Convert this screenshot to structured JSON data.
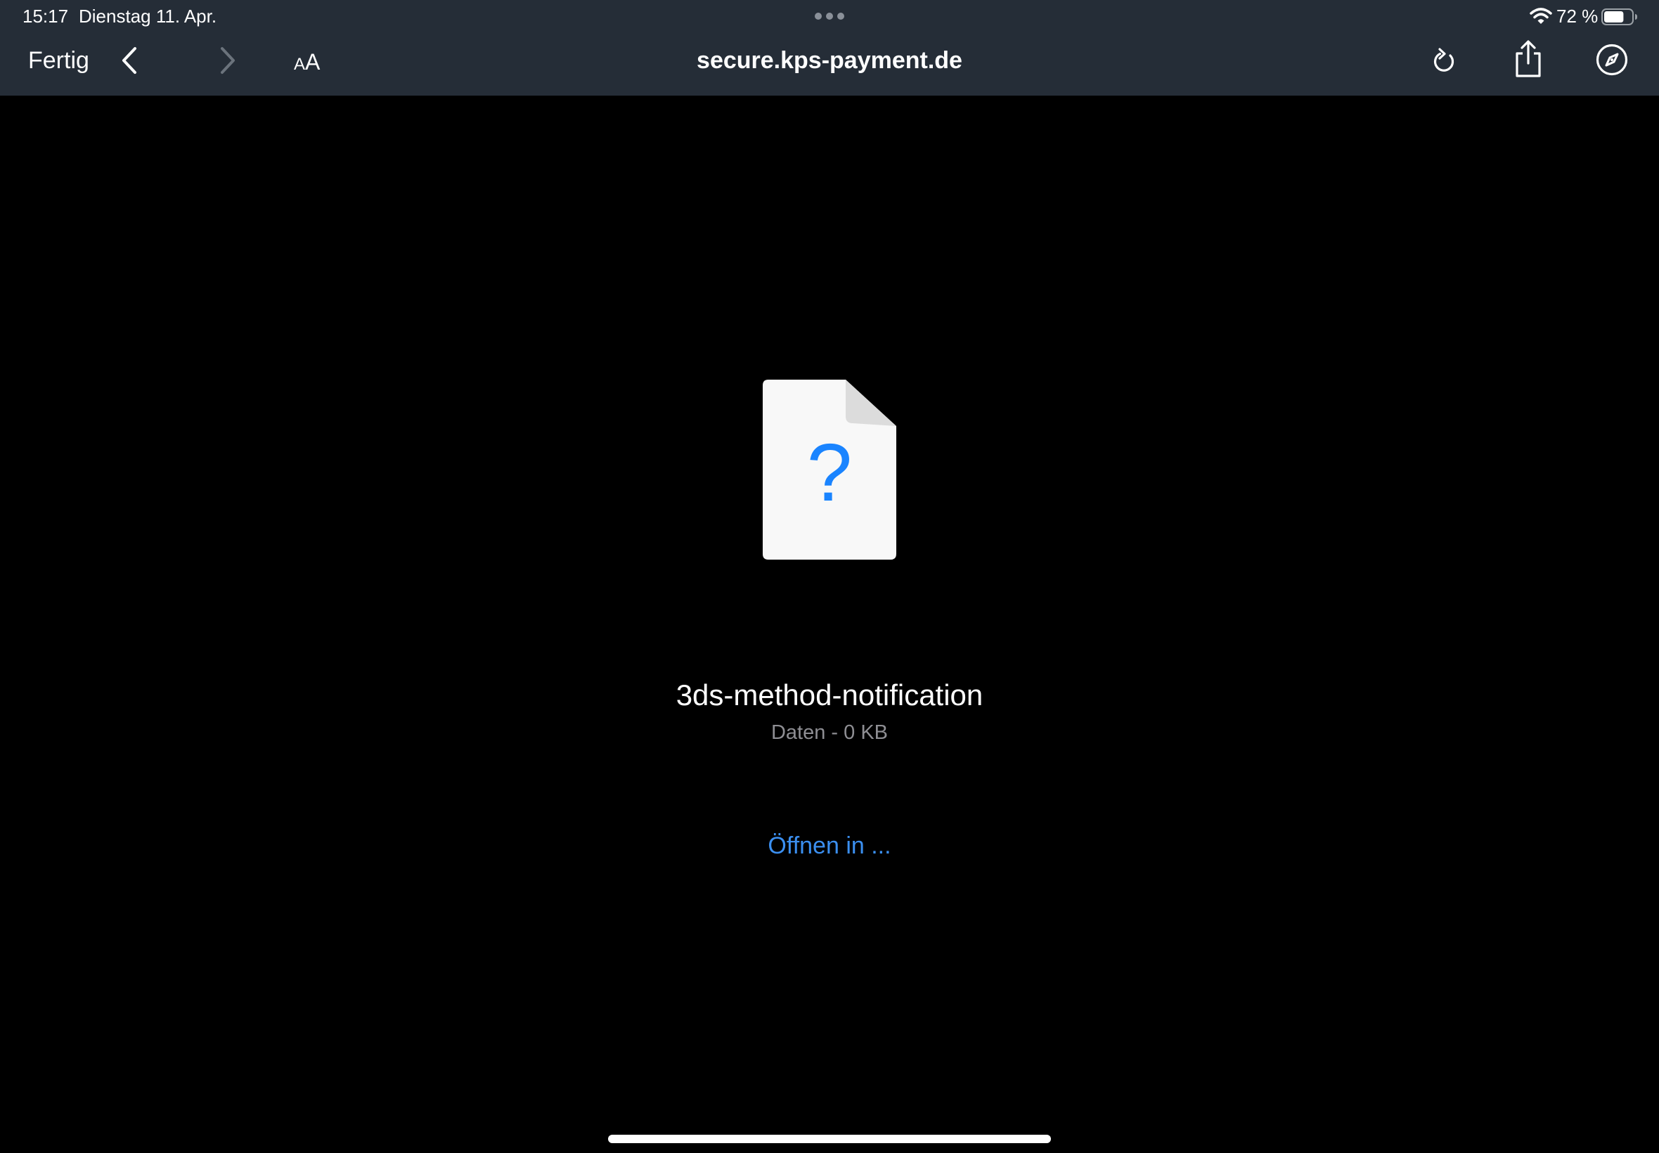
{
  "status_bar": {
    "time": "15:17",
    "date": "Dienstag 11. Apr.",
    "battery_percent": "72 %",
    "battery_level": 0.72
  },
  "toolbar": {
    "done_label": "Fertig",
    "text_size_small": "A",
    "text_size_large": "A",
    "url": "secure.kps-payment.de"
  },
  "icons": {
    "back": "chevron-left-icon",
    "forward": "chevron-right-icon",
    "reload": "reload-icon",
    "share": "share-icon",
    "compass": "compass-icon",
    "file": "unknown-file-icon"
  },
  "file": {
    "name": "3ds-method-notification",
    "meta": "Daten - 0 KB",
    "icon_glyph": "?"
  },
  "actions": {
    "open_in_label": "Öffnen in ..."
  },
  "colors": {
    "toolbar_bg": "#252d37",
    "content_bg": "#000000",
    "accent": "#3b8ff0",
    "file_icon_glyph": "#1a84ff",
    "muted_text": "#8e8e93"
  }
}
